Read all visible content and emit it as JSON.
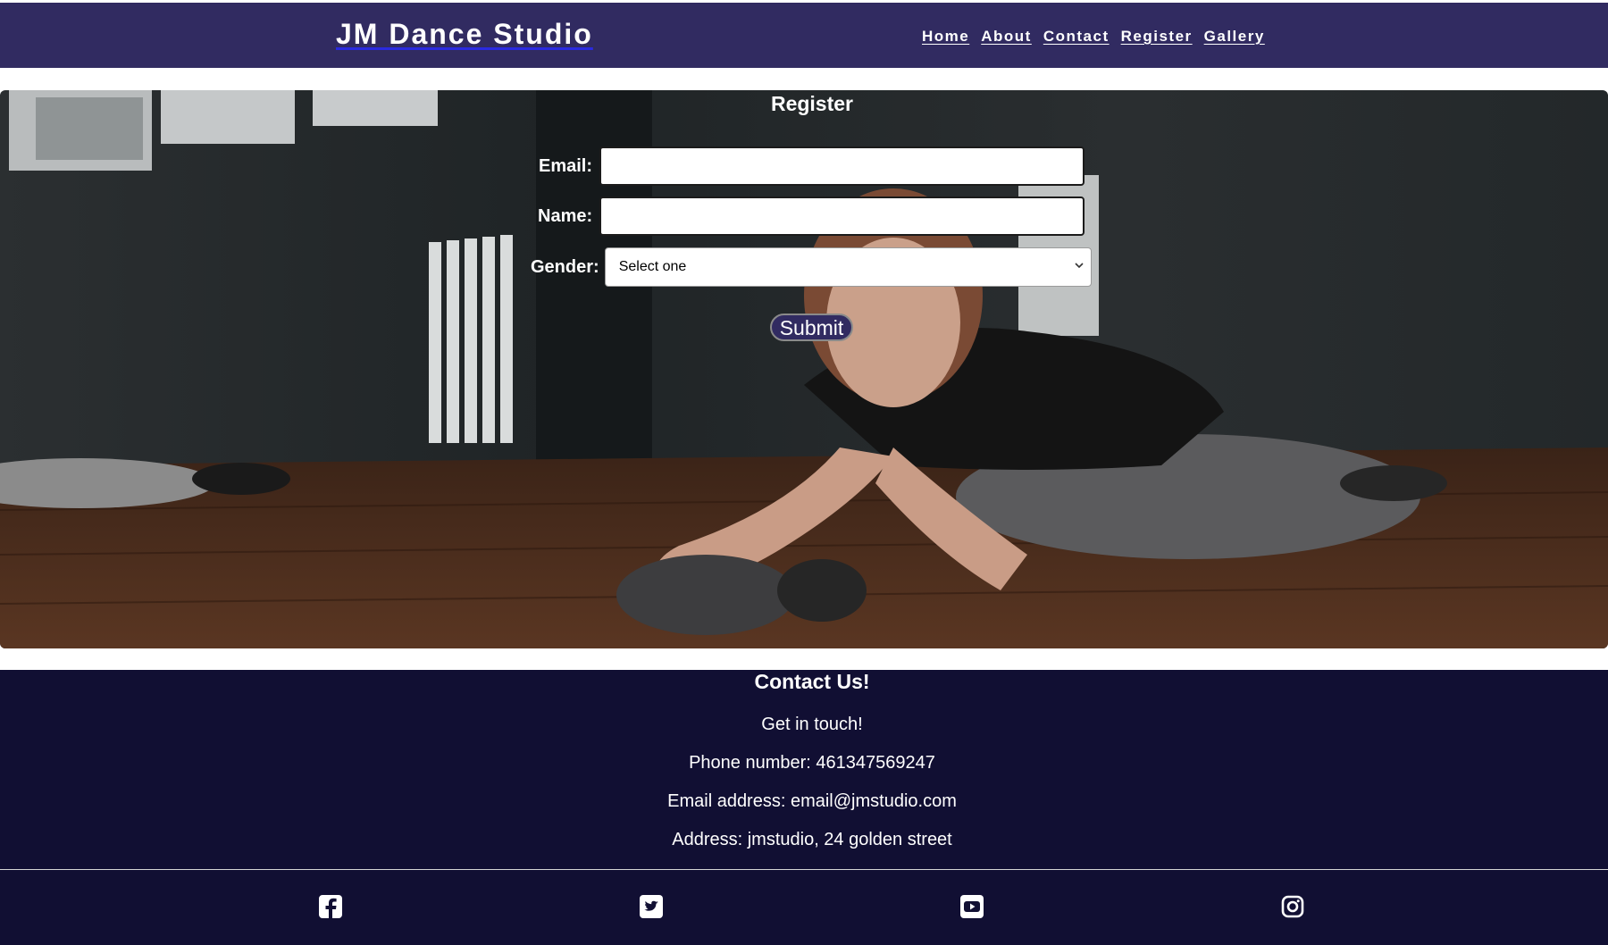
{
  "header": {
    "brand": "JM Dance Studio",
    "nav": [
      "Home",
      "About",
      "Contact",
      "Register",
      "Gallery"
    ]
  },
  "register": {
    "title": "Register",
    "email_label": "Email:",
    "email_value": "",
    "name_label": "Name:",
    "name_value": "",
    "gender_label": "Gender:",
    "gender_selected": "Select one",
    "submit_label": "Submit"
  },
  "footer": {
    "title": "Contact Us!",
    "tagline": "Get in touch!",
    "phone": "Phone number: 461347569247",
    "email": "Email address: email@jmstudio.com",
    "address": "Address: jmstudio, 24 golden street",
    "social_icons": [
      "facebook-icon",
      "twitter-icon",
      "youtube-icon",
      "instagram-icon"
    ]
  },
  "colors": {
    "header_bg": "#312b61",
    "footer_bg": "#110f33",
    "submit_bg": "#312b61",
    "brand_underline": "#2a2ae0"
  }
}
